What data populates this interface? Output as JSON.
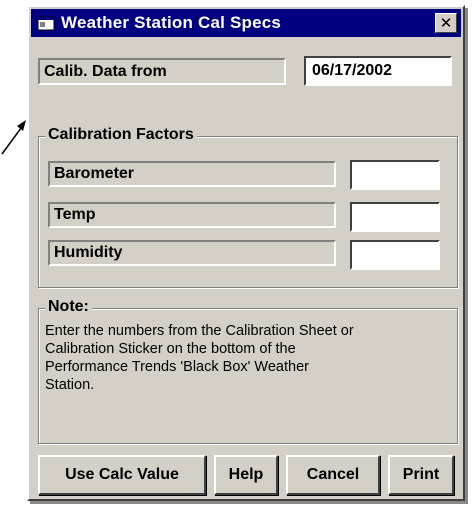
{
  "window": {
    "title": "Weather Station Cal Specs",
    "close_glyph": "✕"
  },
  "calib": {
    "label": "Calib. Data from",
    "date": "06/17/2002"
  },
  "factors": {
    "legend": "Calibration Factors",
    "items": [
      {
        "label": "Barometer",
        "value": ""
      },
      {
        "label": "Temp",
        "value": ""
      },
      {
        "label": "Humidity",
        "value": ""
      }
    ]
  },
  "note": {
    "legend": "Note:",
    "lines": [
      "Enter the numbers from the Calibration Sheet or",
      "Calibration Sticker on the bottom of the",
      "Performance Trends 'Black Box' Weather",
      "Station."
    ]
  },
  "buttons": {
    "use_calc": "Use Calc Value",
    "help": "Help",
    "cancel": "Cancel",
    "print": "Print"
  },
  "colors": {
    "face": "#d4d0c8",
    "titlebar": "#000080"
  }
}
